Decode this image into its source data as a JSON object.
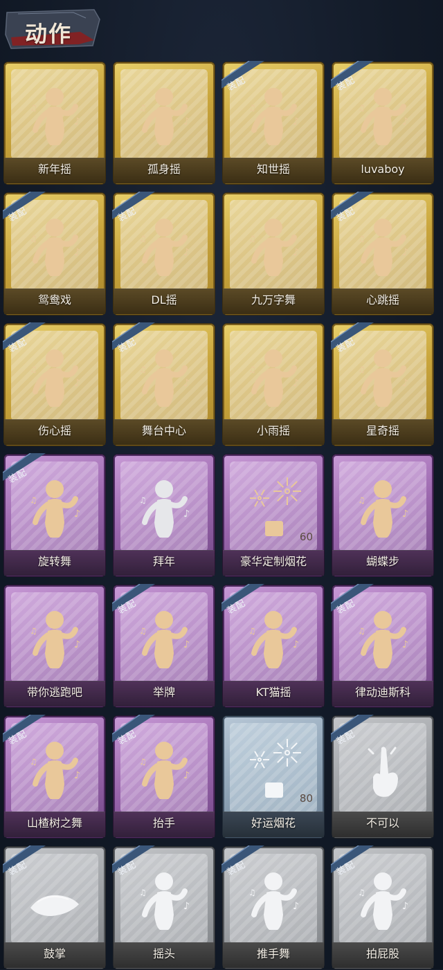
{
  "header": {
    "title": "动作"
  },
  "equip_label": "装配",
  "rows": [
    [
      {
        "name": "新年摇",
        "rarity": "gold",
        "equipped": false,
        "figure": "dance-figure-icon"
      },
      {
        "name": "孤身摇",
        "rarity": "gold",
        "equipped": false,
        "figure": "dance-figure-icon"
      },
      {
        "name": "知世摇",
        "rarity": "gold",
        "equipped": true,
        "figure": "dance-figure-icon"
      },
      {
        "name": "luvaboy",
        "rarity": "gold",
        "equipped": true,
        "figure": "dance-figure-icon"
      }
    ],
    [
      {
        "name": "鸳鸯戏",
        "rarity": "gold",
        "equipped": true,
        "figure": "dance-figure-icon"
      },
      {
        "name": "DL摇",
        "rarity": "gold",
        "equipped": true,
        "figure": "dance-figure-icon"
      },
      {
        "name": "九万字舞",
        "rarity": "gold",
        "equipped": false,
        "figure": "dance-figure-icon"
      },
      {
        "name": "心跳摇",
        "rarity": "gold",
        "equipped": true,
        "figure": "dance-figure-icon"
      }
    ],
    [
      {
        "name": "伤心摇",
        "rarity": "gold",
        "equipped": true,
        "figure": "heart-hands-figure-icon"
      },
      {
        "name": "舞台中心",
        "rarity": "gold",
        "equipped": true,
        "figure": "dance-figure-icon"
      },
      {
        "name": "小雨摇",
        "rarity": "gold",
        "equipped": false,
        "figure": "dance-figure-icon"
      },
      {
        "name": "星奇摇",
        "rarity": "gold",
        "equipped": true,
        "figure": "dance-figure-icon"
      }
    ],
    [
      {
        "name": "旋转舞",
        "rarity": "purple",
        "equipped": true,
        "figure": "spin-figure-icon"
      },
      {
        "name": "拜年",
        "rarity": "purple",
        "equipped": false,
        "figure": "bow-figure-icon"
      },
      {
        "name": "豪华定制烟花",
        "rarity": "purple",
        "equipped": false,
        "figure": "fireworks-icon",
        "count": "60"
      },
      {
        "name": "蝴蝶步",
        "rarity": "purple",
        "equipped": false,
        "figure": "dance-figure-icon"
      }
    ],
    [
      {
        "name": "带你逃跑吧",
        "rarity": "purple",
        "equipped": false,
        "figure": "dance-figure-icon"
      },
      {
        "name": "举牌",
        "rarity": "purple",
        "equipped": true,
        "figure": "sign-figure-icon"
      },
      {
        "name": "KT猫摇",
        "rarity": "purple",
        "equipped": true,
        "figure": "dance-figure-icon"
      },
      {
        "name": "律动迪斯科",
        "rarity": "purple",
        "equipped": true,
        "figure": "disco-figure-icon"
      }
    ],
    [
      {
        "name": "山楂树之舞",
        "rarity": "purple",
        "equipped": true,
        "figure": "dance-figure-icon"
      },
      {
        "name": "抬手",
        "rarity": "purple",
        "equipped": true,
        "figure": "raise-hand-figure-icon"
      },
      {
        "name": "好运烟花",
        "rarity": "blue",
        "equipped": false,
        "figure": "lucky-fireworks-icon",
        "count": "80"
      },
      {
        "name": "不可以",
        "rarity": "gray",
        "equipped": true,
        "figure": "finger-wag-icon"
      }
    ],
    [
      {
        "name": "鼓掌",
        "rarity": "gray",
        "equipped": true,
        "figure": "clap-hands-icon"
      },
      {
        "name": "摇头",
        "rarity": "gray",
        "equipped": true,
        "figure": "shake-head-figure-icon"
      },
      {
        "name": "推手舞",
        "rarity": "gray",
        "equipped": true,
        "figure": "push-hands-figure-icon"
      },
      {
        "name": "拍屁股",
        "rarity": "gray",
        "equipped": true,
        "figure": "dance-figure-icon"
      }
    ]
  ]
}
